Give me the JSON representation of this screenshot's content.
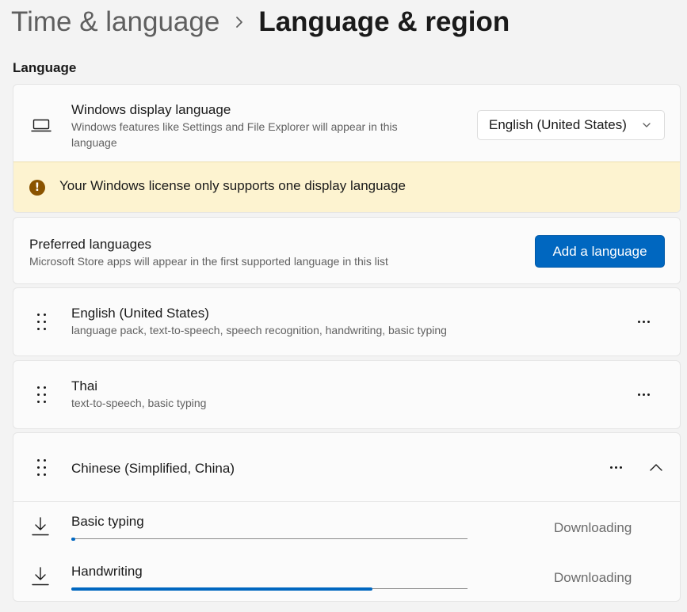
{
  "breadcrumb": {
    "parent": "Time & language",
    "separator_icon": "chevron-right-icon",
    "current": "Language & region"
  },
  "section_title": "Language",
  "display_language": {
    "title": "Windows display language",
    "description": "Windows features like Settings and File Explorer will appear in this language",
    "icon": "laptop-icon",
    "selected": "English (United States)",
    "warning": {
      "icon": "warning-icon",
      "glyph": "!",
      "text": "Your Windows license only supports one display language"
    }
  },
  "preferred": {
    "title": "Preferred languages",
    "description": "Microsoft Store apps will appear in the first supported language in this list",
    "add_button": "Add a language"
  },
  "languages": [
    {
      "name": "English (United States)",
      "features": "language pack, text-to-speech, speech recognition, handwriting, basic typing"
    },
    {
      "name": "Thai",
      "features": "text-to-speech, basic typing"
    },
    {
      "name": "Chinese (Simplified, China)",
      "expanded": true,
      "downloads": [
        {
          "name": "Basic typing",
          "status": "Downloading",
          "progress": 0.01
        },
        {
          "name": "Handwriting",
          "status": "Downloading",
          "progress": 0.76
        }
      ]
    }
  ],
  "colors": {
    "accent": "#0067c0",
    "warning_bg": "#fdf3d0",
    "warning_icon": "#8a5300"
  }
}
